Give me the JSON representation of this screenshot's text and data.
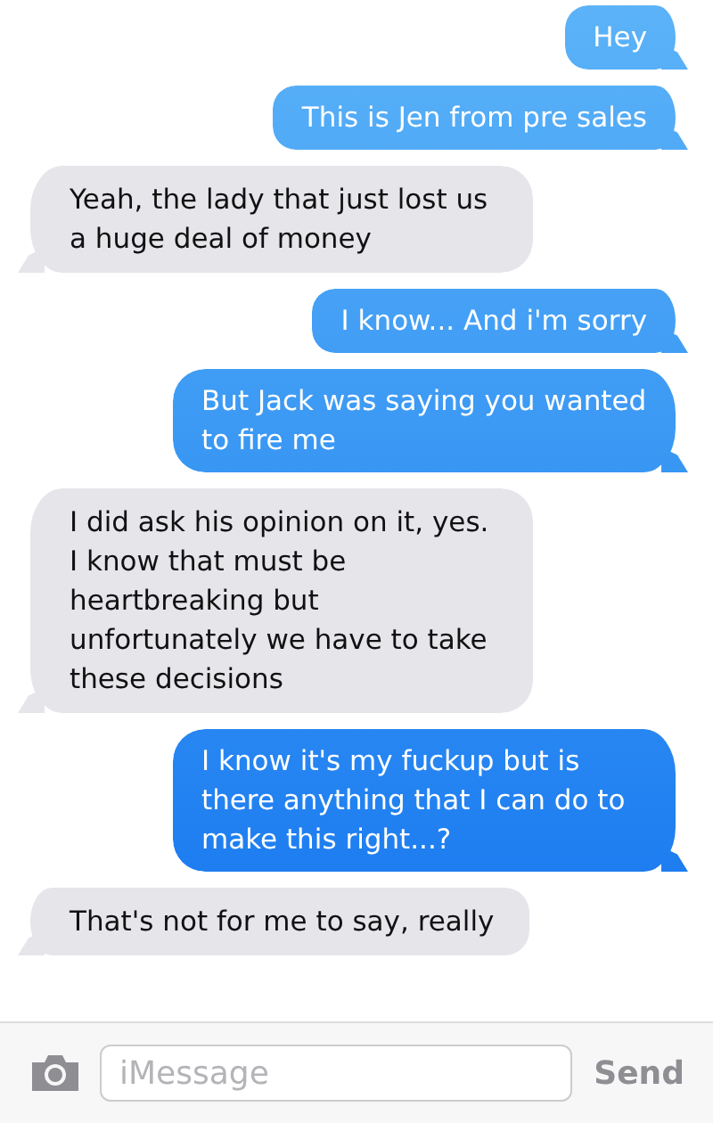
{
  "messages": [
    {
      "kind": "sent",
      "text": "Hey"
    },
    {
      "kind": "sent",
      "text": "This is Jen from pre sales"
    },
    {
      "kind": "received",
      "text": "Yeah, the lady that just lost us a huge deal of money"
    },
    {
      "kind": "sent",
      "text": "I know... And i'm sorry"
    },
    {
      "kind": "sent",
      "text": "But Jack was saying you wanted to fire me"
    },
    {
      "kind": "received",
      "text": "I did ask his opinion on it, yes. I know that must be heartbreaking but unfortunately we have to take these decisions"
    },
    {
      "kind": "sent",
      "text": "I know it's my fuckup but is there anything that I can do to make this right...?"
    },
    {
      "kind": "received",
      "text": "That's not for me to say, really"
    }
  ],
  "composer": {
    "placeholder": "iMessage",
    "send": {
      "label": "Send",
      "disabled": true
    }
  }
}
